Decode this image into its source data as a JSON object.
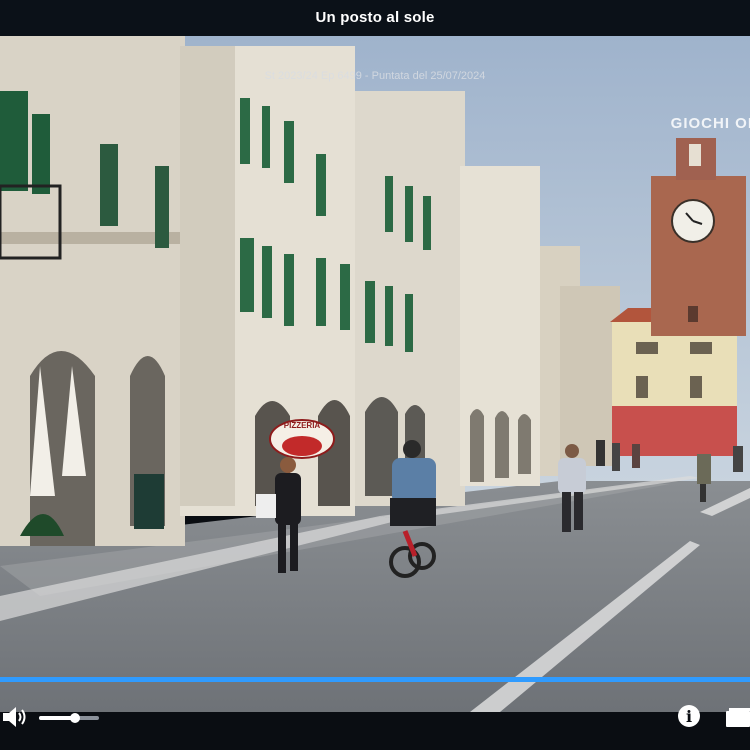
{
  "player": {
    "title": "Un posto al sole",
    "subtitle": "St 2023/24 Ep 6499 - Puntata del 25/07/2024",
    "watermark": "GIOCHI OL",
    "progress": 1.0,
    "volume": 0.6
  },
  "icons": {
    "volume": "speaker-icon",
    "info": "info-icon",
    "fullscreen": "fullscreen-icon"
  },
  "scene": {
    "pizzeria_sign": "PIZZERIA"
  },
  "colors": {
    "progress": "#2f9bff",
    "bar_background": "#0b1118",
    "controls_foreground": "#ffffff"
  }
}
